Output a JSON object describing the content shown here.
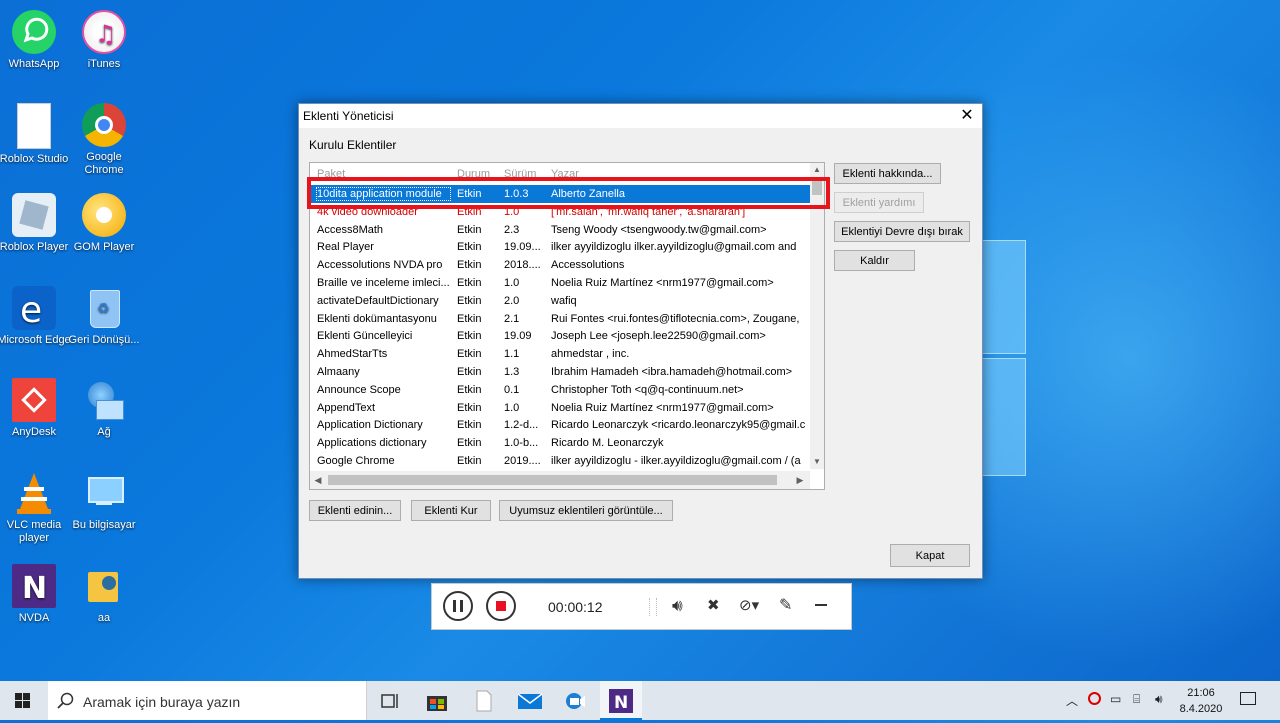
{
  "desktop": {
    "icons": [
      {
        "label": "WhatsApp"
      },
      {
        "label": "iTunes"
      },
      {
        "label": "Roblox Studio"
      },
      {
        "label": "Google Chrome"
      },
      {
        "label": "Roblox Player"
      },
      {
        "label": "GOM Player"
      },
      {
        "label": "Microsoft Edge"
      },
      {
        "label": "Geri Dönüşü..."
      },
      {
        "label": "AnyDesk"
      },
      {
        "label": "Ağ"
      },
      {
        "label": "VLC media player"
      },
      {
        "label": "Bu bilgisayar"
      },
      {
        "label": "NVDA"
      },
      {
        "label": "aa"
      }
    ]
  },
  "dialog": {
    "title": "Eklenti Yöneticisi",
    "close": "✕",
    "section_label": "Kurulu Eklentiler",
    "columns": [
      "Paket",
      "Durum",
      "Sürüm",
      "Yazar"
    ],
    "rows": [
      [
        "10dita application module",
        "Etkin",
        "1.0.3",
        "Alberto Zanella"
      ],
      [
        "4k video downloader",
        "Etkin",
        "1.0",
        "['mr.salah', 'mr.wafiq taher', 'a.shararah']"
      ],
      [
        "Access8Math",
        "Etkin",
        "2.3",
        "Tseng Woody <tsengwoody.tw@gmail.com>"
      ],
      [
        "Real Player",
        "Etkin",
        "19.09...",
        "ilker ayyildizoglu  ilker.ayyildizoglu@gmail.com and"
      ],
      [
        "Accessolutions NVDA pro",
        "Etkin",
        "2018....",
        "Accessolutions"
      ],
      [
        "Braille ve inceleme imleci...",
        "Etkin",
        "1.0",
        "Noelia Ruiz Martínez <nrm1977@gmail.com>"
      ],
      [
        "activateDefaultDictionary",
        "Etkin",
        "2.0",
        "wafiq"
      ],
      [
        "Eklenti dokümantasyonu",
        "Etkin",
        "2.1",
        "Rui Fontes <rui.fontes@tiflotecnia.com>, Zougane,"
      ],
      [
        "Eklenti Güncelleyici",
        "Etkin",
        "19.09",
        "Joseph Lee <joseph.lee22590@gmail.com>"
      ],
      [
        "AhmedStarTts",
        "Etkin",
        "1.1",
        "ahmedstar , inc."
      ],
      [
        "Almaany",
        "Etkin",
        "1.3",
        "Ibrahim Hamadeh <ibra.hamadeh@hotmail.com>"
      ],
      [
        "Announce Scope",
        "Etkin",
        "0.1",
        "Christopher Toth <q@q-continuum.net>"
      ],
      [
        "AppendText",
        "Etkin",
        "1.0",
        "Noelia Ruiz Martínez <nrm1977@gmail.com>"
      ],
      [
        "Application Dictionary",
        "Etkin",
        "1.2-d...",
        "Ricardo Leonarczyk <ricardo.leonarczyk95@gmail.c"
      ],
      [
        "Applications dictionary",
        "Etkin",
        "1.0-b...",
        "Ricardo M. Leonarczyk"
      ],
      [
        "Google Chrome",
        "Etkin",
        "2019....",
        "ilker ayyildizoglu - ilker.ayyildizoglu@gmail.com / (a"
      ]
    ],
    "side_buttons": {
      "about": "Eklenti hakkında...",
      "help": "Eklenti yardımı",
      "disable": "Eklentiyi Devre dışı bırak",
      "remove": "Kaldır"
    },
    "bottom_buttons": {
      "get": "Eklenti edinin...",
      "install": "Eklenti Kur",
      "incompatible": "Uyumsuz eklentileri görüntüle..."
    },
    "close_button": "Kapat"
  },
  "recorder": {
    "time": "00:00:12"
  },
  "taskbar": {
    "search_placeholder": "Aramak için buraya yazın",
    "time": "21:06",
    "date": "8.4.2020"
  },
  "colors": {
    "selection": "#0a78d7",
    "highlight_box": "#e8141c",
    "record_stop": "#e81123"
  }
}
